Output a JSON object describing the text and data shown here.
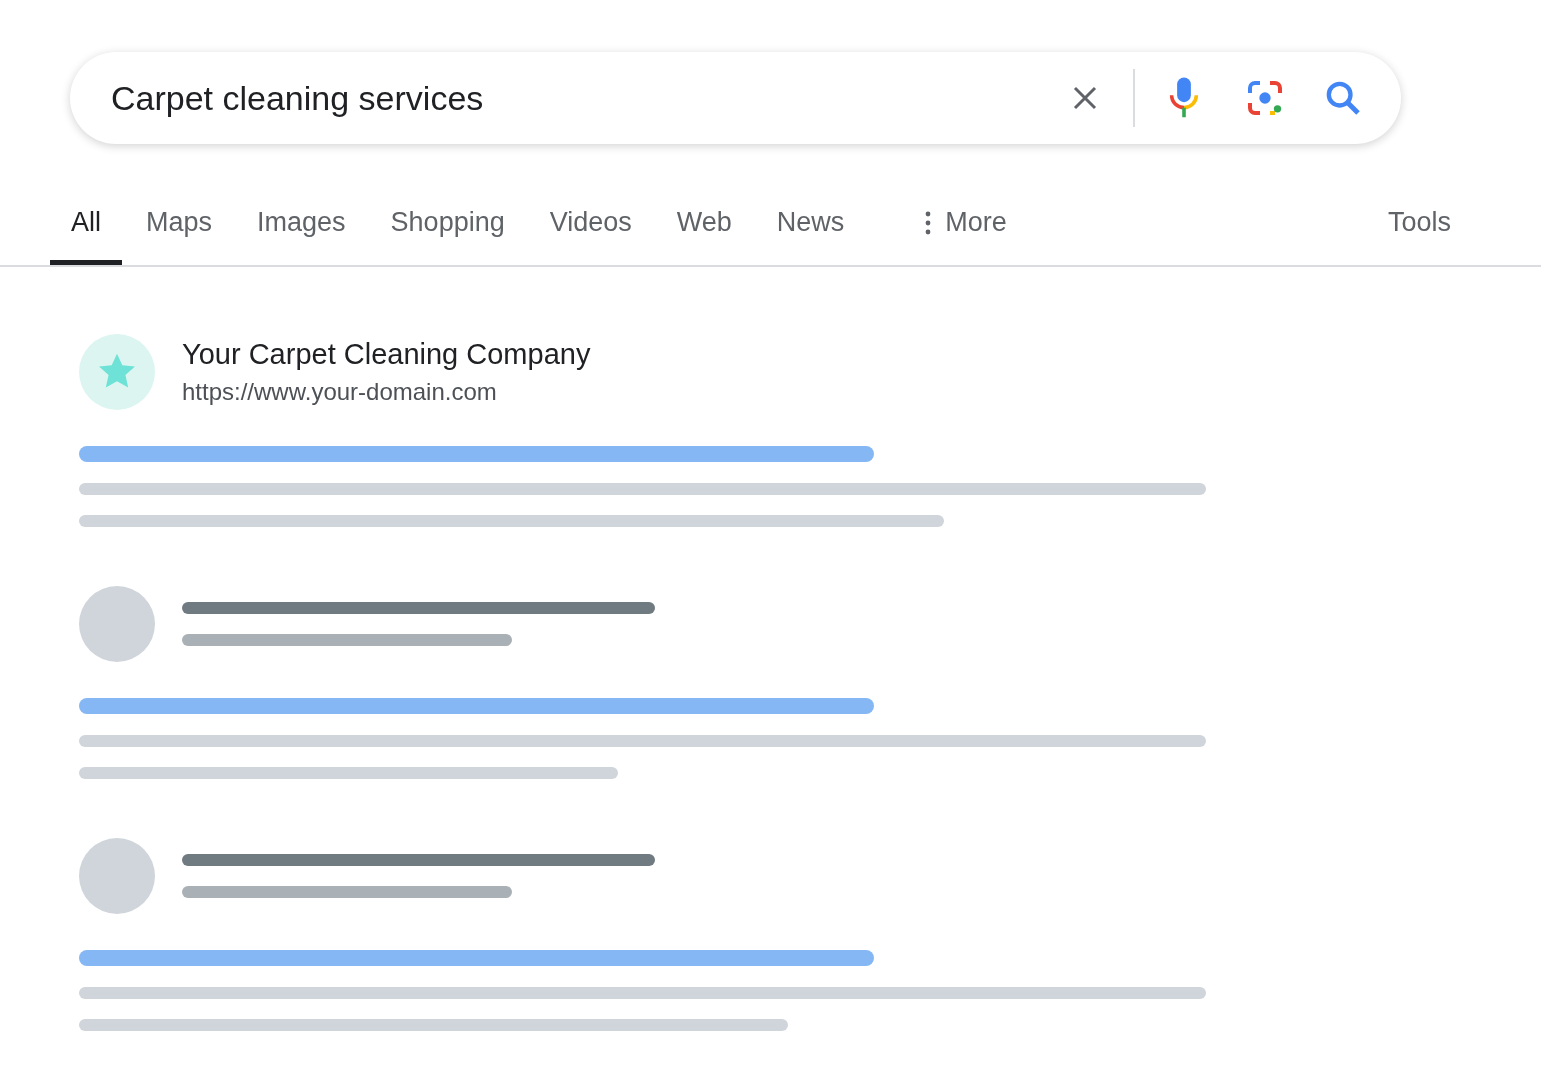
{
  "search": {
    "value": "Carpet cleaning services"
  },
  "tabs": [
    {
      "label": "All",
      "selected": true,
      "kind": "tab"
    },
    {
      "label": "Maps",
      "selected": false,
      "kind": "tab"
    },
    {
      "label": "Images",
      "selected": false,
      "kind": "tab"
    },
    {
      "label": "Shopping",
      "selected": false,
      "kind": "tab"
    },
    {
      "label": "Videos",
      "selected": false,
      "kind": "tab"
    },
    {
      "label": "Web",
      "selected": false,
      "kind": "tab"
    },
    {
      "label": "News",
      "selected": false,
      "kind": "tab"
    },
    {
      "label": "More",
      "selected": false,
      "kind": "more"
    }
  ],
  "tools": "Tools",
  "results": [
    {
      "kind": "site",
      "title": "Your Carpet Cleaning Company",
      "url": "https://www.your-domain.com"
    },
    {
      "kind": "placeholder"
    },
    {
      "kind": "placeholder"
    }
  ]
}
